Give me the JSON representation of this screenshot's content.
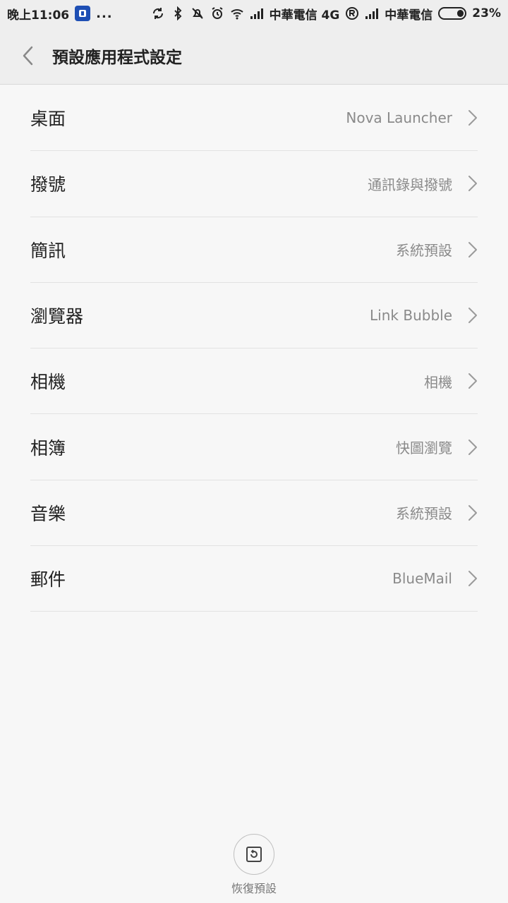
{
  "statusbar": {
    "time": "晚上11:06",
    "more": "...",
    "carrier1": "中華電信 4G",
    "carrier2": "中華電信",
    "battery": "23%"
  },
  "header": {
    "title": "預設應用程式設定"
  },
  "rows": [
    {
      "label": "桌面",
      "value": "Nova Launcher"
    },
    {
      "label": "撥號",
      "value": "通訊錄與撥號"
    },
    {
      "label": "簡訊",
      "value": "系統預設"
    },
    {
      "label": "瀏覽器",
      "value": "Link Bubble"
    },
    {
      "label": "相機",
      "value": "相機"
    },
    {
      "label": "相簿",
      "value": "快圖瀏覽"
    },
    {
      "label": "音樂",
      "value": "系統預設"
    },
    {
      "label": "郵件",
      "value": "BlueMail"
    }
  ],
  "restore": {
    "label": "恢復預設"
  }
}
